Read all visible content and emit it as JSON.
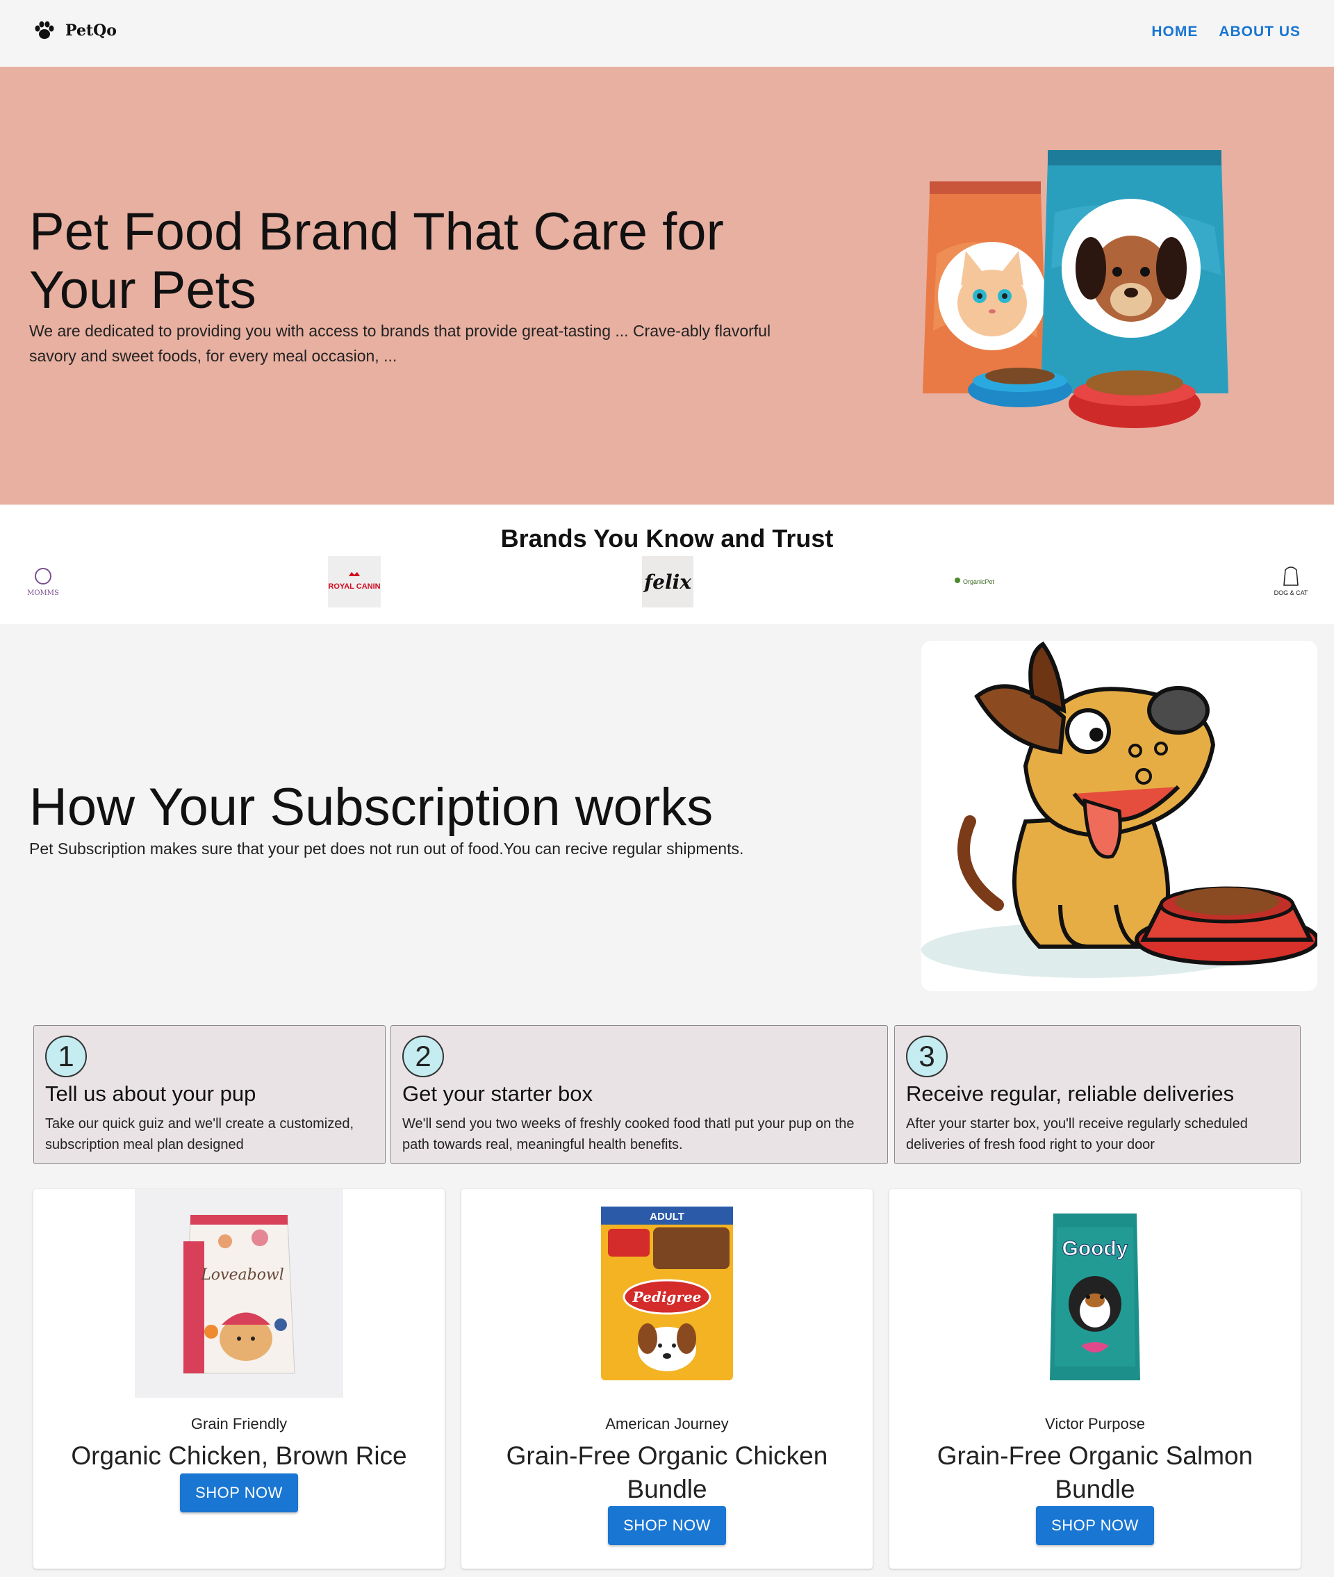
{
  "header": {
    "logo_text": "PetQo",
    "nav": [
      "HOME",
      "ABOUT US"
    ]
  },
  "hero": {
    "title": "Pet Food Brand That Care for Your Pets",
    "description": "We are dedicated to providing you with access to brands that provide great-tasting ... Crave-ably flavorful savory and sweet foods, for every meal occasion, ..."
  },
  "brands": {
    "title": "Brands You Know and Trust",
    "logos": [
      "MOMMS",
      "ROYAL CANIN",
      "felix",
      "OrganicPet",
      "DOG & CAT"
    ]
  },
  "subscription": {
    "title": "How Your Subscription works",
    "description": "Pet Subscription makes sure that your pet does not run out of food.You can recive regular shipments."
  },
  "steps": [
    {
      "number": "1",
      "title": "Tell us about your pup",
      "description": "Take our quick guiz and we'll create a customized, subscription meal plan designed"
    },
    {
      "number": "2",
      "title": "Get your starter box",
      "description": "We'll send you two weeks of freshly cooked food thatl put your pup on the path towards real, meaningful health benefits."
    },
    {
      "number": "3",
      "title": "Receive regular, reliable deliveries",
      "description": "After your starter box, you'll receive regularly scheduled deliveries of fresh food right to your door"
    }
  ],
  "products": [
    {
      "brand": "Grain Friendly",
      "name": "Organic Chicken, Brown Rice",
      "button": "SHOP NOW",
      "package_text": "Loveabowl"
    },
    {
      "brand": "American Journey",
      "name": "Grain-Free Organic Chicken Bundle",
      "button": "SHOP NOW",
      "package_text": "Pedigree",
      "package_label": "ADULT"
    },
    {
      "brand": "Victor Purpose",
      "name": "Grain-Free Organic Salmon Bundle",
      "button": "SHOP NOW",
      "package_text": "Goody"
    }
  ],
  "colors": {
    "hero_bg": "#e8b0a1",
    "accent": "#1976d2",
    "step_bg": "#e9e3e6",
    "step_circle": "#c5ecf0"
  }
}
